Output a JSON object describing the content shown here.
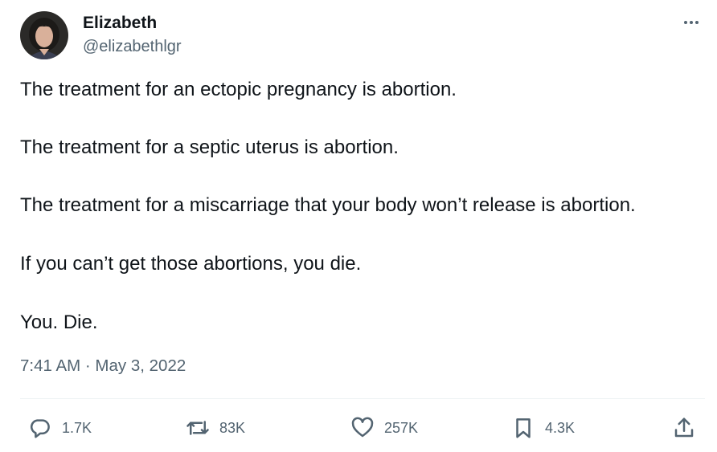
{
  "author": {
    "name": "Elizabeth",
    "handle": "@elizabethlgr"
  },
  "post": {
    "paragraphs": [
      "The treatment for an ectopic pregnancy is abortion.",
      "The treatment for a septic uterus is abortion.",
      "The treatment for a miscarriage that your body won’t release is abortion.",
      "If you can’t get those abortions, you die.",
      "You. Die."
    ],
    "timestamp": "7:41 AM · May 3, 2022"
  },
  "actions": {
    "replies": "1.7K",
    "reposts": "83K",
    "likes": "257K",
    "bookmarks": "4.3K"
  },
  "icons": [
    "more-icon",
    "reply-icon",
    "repost-icon",
    "like-icon",
    "bookmark-icon",
    "share-icon"
  ]
}
